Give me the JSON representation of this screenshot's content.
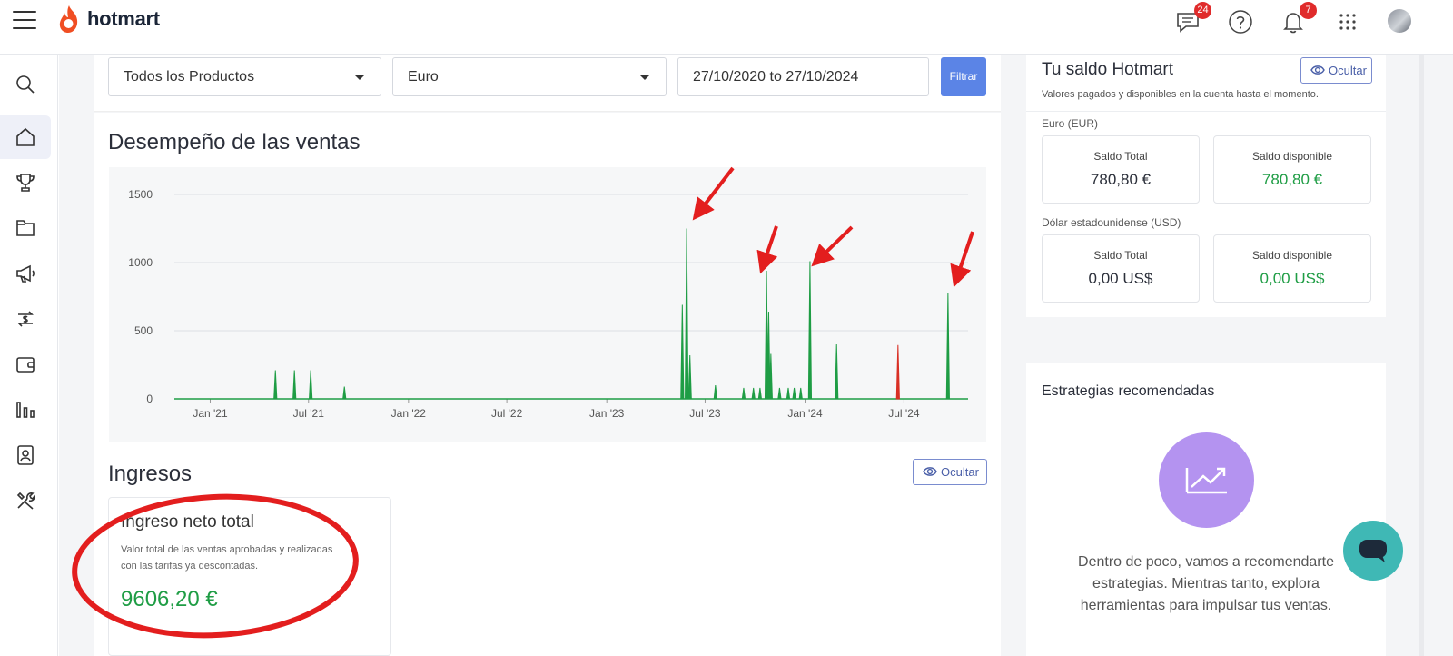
{
  "header": {
    "logo_text": "hotmart",
    "messages_badge": "24",
    "notifications_badge": "7",
    "icons": [
      "menu-icon",
      "chat-icon",
      "help-icon",
      "bell-icon",
      "apps-grid-icon",
      "avatar"
    ]
  },
  "sidebar": {
    "items": [
      {
        "name": "search",
        "icon": "search-icon"
      },
      {
        "name": "home",
        "icon": "home-icon",
        "active": true
      },
      {
        "name": "trophy",
        "icon": "trophy-icon"
      },
      {
        "name": "products",
        "icon": "folder-icon"
      },
      {
        "name": "marketing",
        "icon": "megaphone-icon"
      },
      {
        "name": "transactions",
        "icon": "money-exchange-icon"
      },
      {
        "name": "wallet",
        "icon": "wallet-icon"
      },
      {
        "name": "analytics",
        "icon": "bar-chart-icon"
      },
      {
        "name": "contacts",
        "icon": "contact-icon"
      },
      {
        "name": "tools",
        "icon": "tools-icon"
      }
    ]
  },
  "filters": {
    "product_select": "Todos los Productos",
    "currency_select": "Euro",
    "date_range": "27/10/2020 to 27/10/2024",
    "filter_button": "Filtrar"
  },
  "sales": {
    "title": "Desempeño de las ventas"
  },
  "chart_data": {
    "type": "area",
    "title": "",
    "xlabel": "",
    "ylabel": "",
    "ylim": [
      0,
      1500
    ],
    "y_ticks": [
      "1500",
      "1000",
      "500",
      "0"
    ],
    "x_ticks": [
      "Jan '21",
      "Jul '21",
      "Jan '22",
      "Jul '22",
      "Jan '23",
      "Jul '23",
      "Jan '24",
      "Jul '24"
    ],
    "x_range": [
      "2020-10-27",
      "2024-10-27"
    ],
    "grid": true,
    "series": [
      {
        "color": "#1f9d45",
        "points": [
          [
            "2021-05-01",
            210
          ],
          [
            "2021-06-05",
            210
          ],
          [
            "2021-07-05",
            210
          ],
          [
            "2021-09-05",
            90
          ],
          [
            "2023-05-20",
            690
          ],
          [
            "2023-05-28",
            1250
          ],
          [
            "2023-06-03",
            320
          ],
          [
            "2023-07-20",
            100
          ],
          [
            "2023-09-10",
            80
          ],
          [
            "2023-09-28",
            80
          ],
          [
            "2023-10-10",
            80
          ],
          [
            "2023-10-22",
            940
          ],
          [
            "2023-10-26",
            640
          ],
          [
            "2023-10-30",
            330
          ],
          [
            "2023-11-15",
            80
          ],
          [
            "2023-12-01",
            80
          ],
          [
            "2023-12-12",
            80
          ],
          [
            "2023-12-24",
            80
          ],
          [
            "2024-01-10",
            1010
          ],
          [
            "2024-02-28",
            400
          ],
          [
            "2024-09-20",
            780
          ]
        ]
      },
      {
        "color": "#d93025",
        "points": [
          [
            "2024-06-20",
            395
          ]
        ]
      }
    ]
  },
  "income": {
    "title": "Ingresos",
    "hide_button": "Ocultar",
    "box_title": "Ingreso neto total",
    "box_desc_1": "Valor total de las ventas aprobadas y realizadas",
    "box_desc_2": "con las tarifas ya descontadas.",
    "box_value": "9606,20 €"
  },
  "balance": {
    "title": "Tu saldo Hotmart",
    "hide_button": "Ocultar",
    "subtitle": "Valores pagados y disponibles en la cuenta hasta el momento.",
    "eur_label": "Euro (EUR)",
    "eur_total_label": "Saldo Total",
    "eur_total_value": "780,80 €",
    "eur_available_label": "Saldo disponible",
    "eur_available_value": "780,80 €",
    "usd_label": "Dólar estadounidense (USD)",
    "usd_total_label": "Saldo Total",
    "usd_total_value": "0,00 US$",
    "usd_available_label": "Saldo disponible",
    "usd_available_value": "0,00 US$"
  },
  "strategies": {
    "title": "Estrategias recomendadas",
    "line1": "Dentro de poco, vamos a recomendarte",
    "line2": "estrategias. Mientras tanto, explora",
    "line3": "herramientas para impulsar tus ventas."
  },
  "colors": {
    "accent": "#5b84e6",
    "green": "#1f9d45",
    "annotation": "#e31e1e",
    "badge": "#e02b2b",
    "chat": "#3fb8b5",
    "strategy": "#b493f0"
  }
}
